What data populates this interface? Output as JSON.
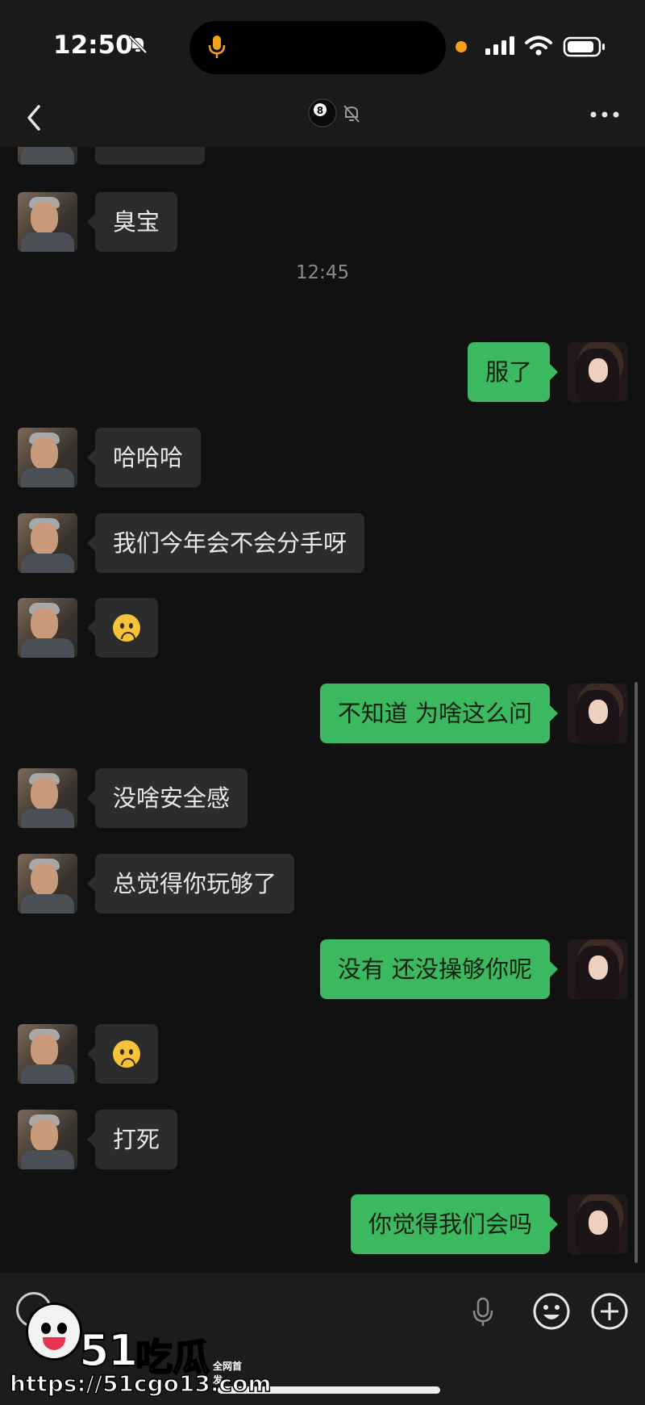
{
  "status_bar": {
    "time": "12:50"
  },
  "nav": {
    "title_emoji": "🎱"
  },
  "messages": [
    {
      "side": "in",
      "text": "臭宝"
    },
    {
      "type": "timestamp",
      "text": "12:45"
    },
    {
      "side": "out",
      "text": "服了"
    },
    {
      "side": "in",
      "text": "哈哈哈"
    },
    {
      "side": "in",
      "text": "我们今年会不会分手呀"
    },
    {
      "side": "in",
      "emoji": "frowning-face"
    },
    {
      "side": "out",
      "text": "不知道 为啥这么问"
    },
    {
      "side": "in",
      "text": "没啥安全感"
    },
    {
      "side": "in",
      "text": "总觉得你玩够了"
    },
    {
      "side": "out",
      "text": "没有 还没操够你呢"
    },
    {
      "side": "in",
      "emoji": "frowning-face"
    },
    {
      "side": "in",
      "text": "打死"
    },
    {
      "side": "out",
      "text": "你觉得我们会吗"
    }
  ],
  "watermark": {
    "brand_num": "51",
    "brand_cn": "吃瓜",
    "badge": "全网首发",
    "url": "https://51cgo13.com"
  },
  "colors": {
    "out_bubble": "#3cb861",
    "in_bubble": "#2c2c2c",
    "background": "#111111"
  }
}
